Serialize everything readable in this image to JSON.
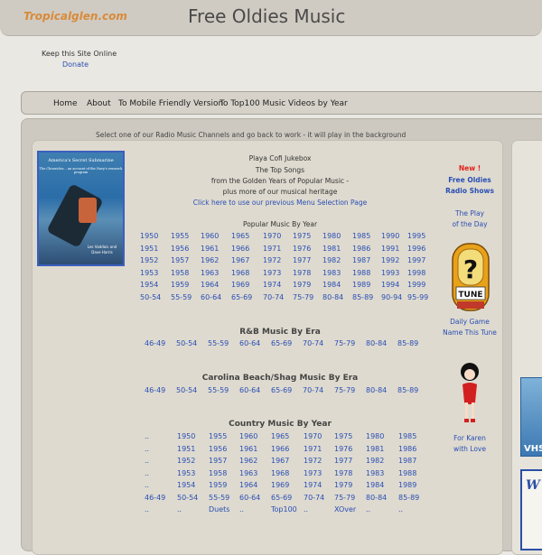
{
  "header": {
    "logo": "Tropicalglen.com",
    "title": "Free Oldies Music",
    "keep_online": "Keep this Site Online",
    "donate": "Donate"
  },
  "nav": {
    "items": [
      "Home",
      "About",
      "To Mobile Friendly Version",
      "To Top100 Music Videos by Year"
    ]
  },
  "main": {
    "select_line": "Select one of our Radio Music Channels and go back to work - it will play in the background",
    "book_title": "America's Secret Submarine",
    "book_subtitle": "The Chronicles... an account of the Navy's research program",
    "book_authors": "Les Vaddois and Dave Harris",
    "intro": [
      "Playa Cofi Jukebox",
      "The Top Songs",
      "from the Golden Years of Popular Music -",
      "plus more of our musical heritage"
    ],
    "menu_link": "Click here to use our previous Menu Selection Page",
    "popular_heading": "Popular Music By Year",
    "popular_rows": [
      [
        "1950",
        "1955",
        "1960",
        "1965",
        "1970",
        "1975",
        "1980",
        "1985",
        "1990",
        "1995"
      ],
      [
        "1951",
        "1956",
        "1961",
        "1966",
        "1971",
        "1976",
        "1981",
        "1986",
        "1991",
        "1996"
      ],
      [
        "1952",
        "1957",
        "1962",
        "1967",
        "1972",
        "1977",
        "1982",
        "1987",
        "1992",
        "1997"
      ],
      [
        "1953",
        "1958",
        "1963",
        "1968",
        "1973",
        "1978",
        "1983",
        "1988",
        "1993",
        "1998"
      ],
      [
        "1954",
        "1959",
        "1964",
        "1969",
        "1974",
        "1979",
        "1984",
        "1989",
        "1994",
        "1999"
      ],
      [
        "50-54",
        "55-59",
        "60-64",
        "65-69",
        "70-74",
        "75-79",
        "80-84",
        "85-89",
        "90-94",
        "95-99"
      ]
    ],
    "rb_heading": "R&B Music By Era",
    "rb_eras": [
      "46-49",
      "50-54",
      "55-59",
      "60-64",
      "65-69",
      "70-74",
      "75-79",
      "80-84",
      "85-89"
    ],
    "shag_heading": "Carolina Beach/Shag Music By Era",
    "shag_eras": [
      "46-49",
      "50-54",
      "55-59",
      "60-64",
      "65-69",
      "70-74",
      "75-79",
      "80-84",
      "85-89"
    ],
    "country_heading": "Country Music By Year",
    "country_rows": [
      [
        "..",
        "1950",
        "1955",
        "1960",
        "1965",
        "1970",
        "1975",
        "1980",
        "1985"
      ],
      [
        "..",
        "1951",
        "1956",
        "1961",
        "1966",
        "1971",
        "1976",
        "1981",
        "1986"
      ],
      [
        "..",
        "1952",
        "1957",
        "1962",
        "1967",
        "1972",
        "1977",
        "1982",
        "1987"
      ],
      [
        "..",
        "1953",
        "1958",
        "1963",
        "1968",
        "1973",
        "1978",
        "1983",
        "1988"
      ],
      [
        "..",
        "1954",
        "1959",
        "1964",
        "1969",
        "1974",
        "1979",
        "1984",
        "1989"
      ],
      [
        "46-49",
        "50-54",
        "55-59",
        "60-64",
        "65-69",
        "70-74",
        "75-79",
        "80-84",
        "85-89"
      ],
      [
        "..",
        "..",
        "Duets",
        "..",
        "Top100",
        "..",
        "XOver",
        "..",
        ".."
      ]
    ]
  },
  "sidebar": {
    "new": "New !",
    "free_oldies": "Free Oldies",
    "radio_shows": "Radio Shows",
    "play_line1": "The Play",
    "play_line2": "of the Day",
    "jukebox_label": "TUNE",
    "daily_game": "Daily Game",
    "name_tune": "Name This Tune",
    "for_karen": "For Karen",
    "with_love": "with Love"
  },
  "right": {
    "vhs_label": "VHS"
  },
  "colors": {
    "link": "#2a4fb5",
    "logo": "#d88a3a",
    "new_red": "#e0221a"
  }
}
